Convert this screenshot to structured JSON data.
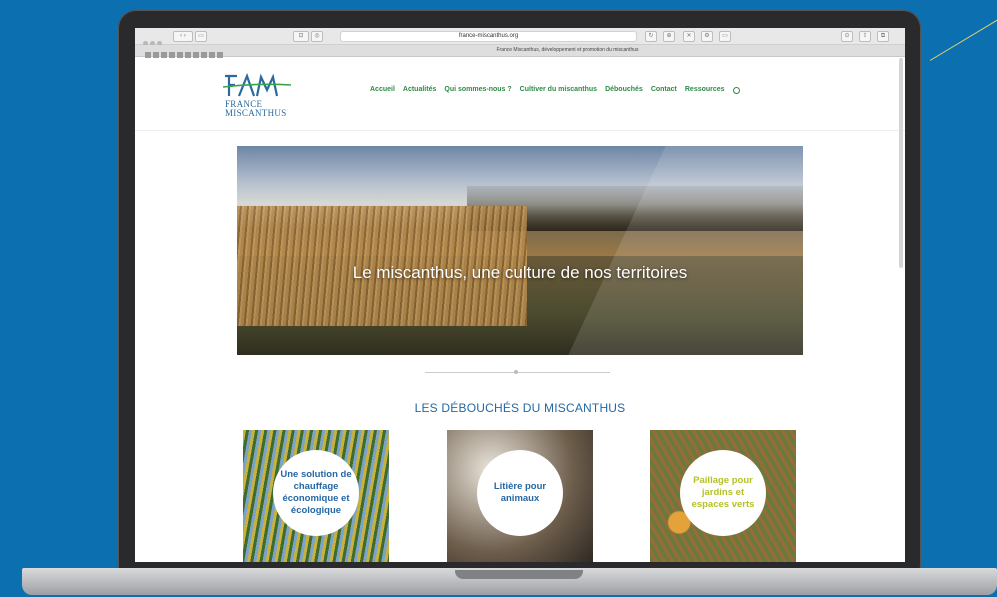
{
  "browser": {
    "address": "france-miscanthus.org",
    "tab_title": "France Miscanthus, développement et promotion du miscanthus"
  },
  "site": {
    "logo_text": [
      "FRANCE",
      "MISCANTHUS"
    ],
    "menu": [
      "Accueil",
      "Actualités",
      "Qui sommes-nous ?",
      "Cultiver du miscanthus",
      "Débouchés",
      "Contact",
      "Ressources"
    ],
    "hero_text": "Le miscanthus, une culture de nos territoires",
    "section_title": "LES DÉBOUCHÉS DU MISCANTHUS",
    "cards": [
      {
        "text": "Une solution de chauffage économique et écologique"
      },
      {
        "text": "Litière pour animaux"
      },
      {
        "text": "Paillage pour jardins et espaces verts"
      }
    ]
  },
  "colors": {
    "background": "#0b6fb0",
    "menu_green": "#2f8a47",
    "title_blue": "#2568a3",
    "card3_text": "#b5c128"
  }
}
